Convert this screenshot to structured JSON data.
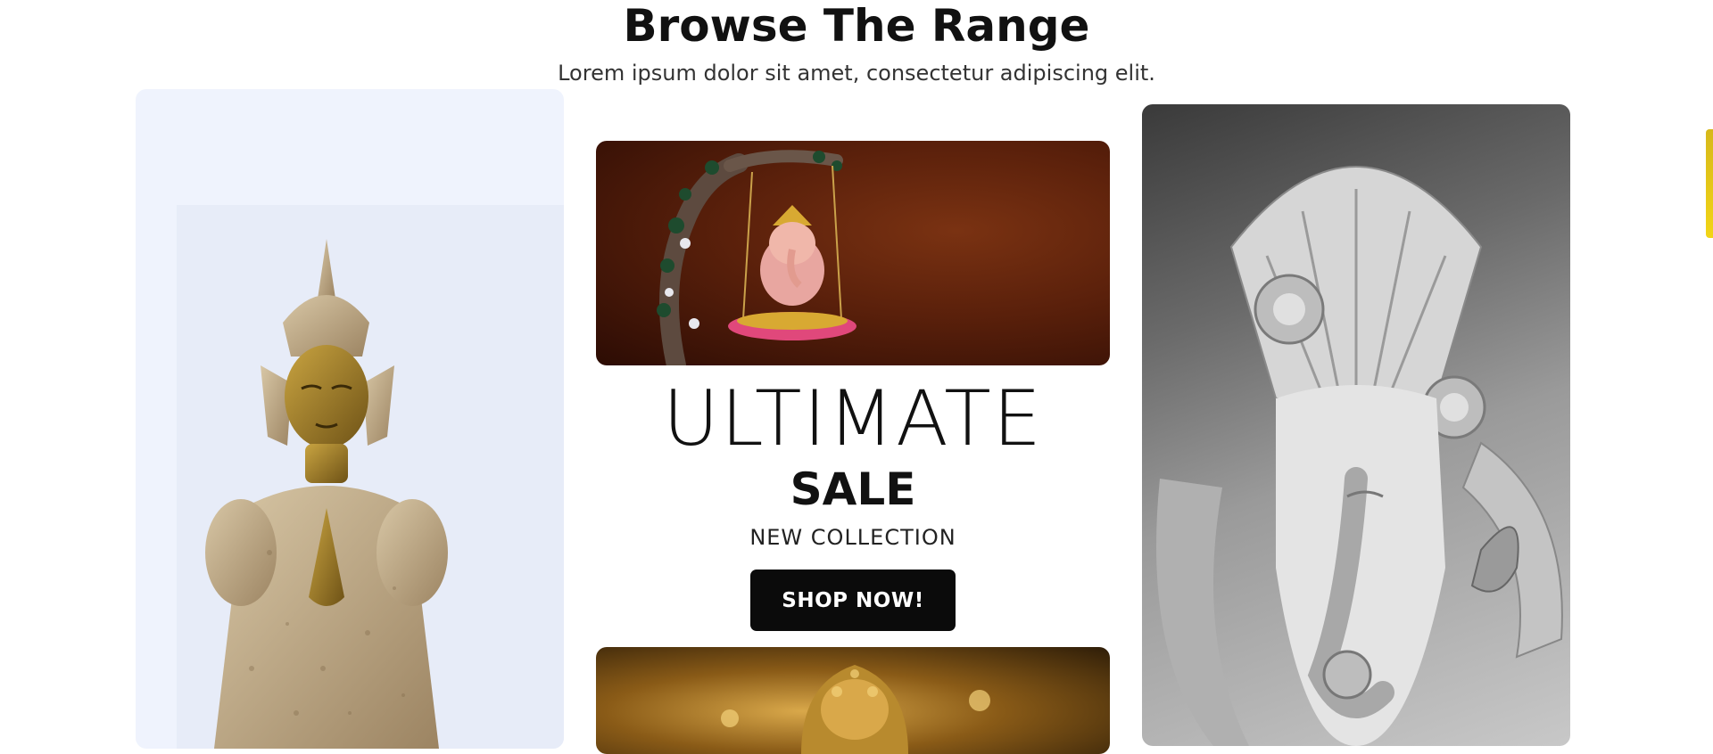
{
  "section": {
    "heading": "Browse The Range",
    "subheading": "Lorem ipsum dolor sit amet, consectetur adipiscing elit."
  },
  "promo": {
    "title": "ULTIMATE",
    "sale": "SALE",
    "subtitle": "NEW COLLECTION",
    "button_label": "SHOP NOW!"
  },
  "images": [
    {
      "name": "buddha-statue-image",
      "icon": "buddha-icon"
    },
    {
      "name": "ganesha-swing-image",
      "icon": "ganesha-icon"
    },
    {
      "name": "ganesha-idol-image",
      "icon": "ganesha-icon"
    },
    {
      "name": "golden-ganesha-image",
      "icon": "ganesha-icon"
    }
  ],
  "colors": {
    "accent": "#0b0b0b",
    "button_text": "#ffffff",
    "scrollbar": "#e8c916",
    "left_card_bg": "#eff3fd"
  }
}
